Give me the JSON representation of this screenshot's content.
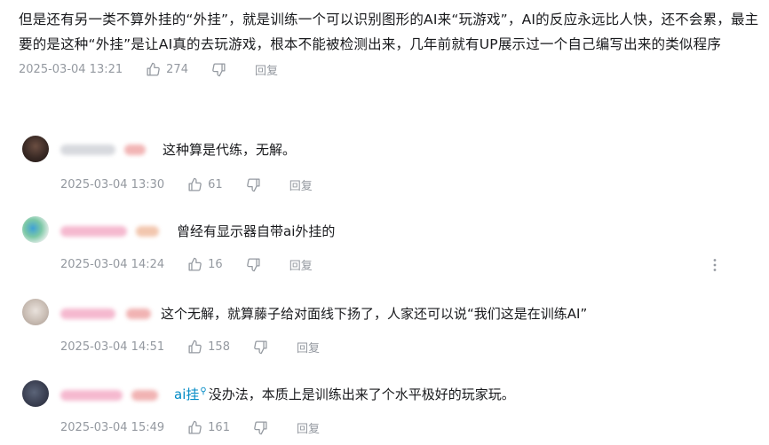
{
  "main_comment": {
    "text": "但是还有另一类不算外挂的“外挂”，就是训练一个可以识别图形的AI来“玩游戏”，AI的反应永远比人快，还不会累，最主要的是这种“外挂”是让AI真的去玩游戏，根本不能被检测出来，几年前就有UP展示过一个自己编写出来的类似程序",
    "time": "2025-03-04 13:21",
    "likes": "274",
    "reply_label": "回复"
  },
  "replies": [
    {
      "text": "这种算是代练，无解。",
      "time": "2025-03-04 13:30",
      "likes": "61",
      "reply_label": "回复"
    },
    {
      "text": "曾经有显示器自带ai外挂的",
      "time": "2025-03-04 14:24",
      "likes": "16",
      "reply_label": "回复"
    },
    {
      "text": "这个无解，就算藤子给对面线下扬了，人家还可以说“我们这是在训练AI”",
      "time": "2025-03-04 14:51",
      "likes": "158",
      "reply_label": "回复"
    },
    {
      "link": "ai挂",
      "text": "没办法，本质上是训练出来了个水平极好的玩家玩。",
      "time": "2025-03-04 15:49",
      "likes": "161",
      "reply_label": "回复"
    }
  ],
  "icons": {
    "like": "thumbs-up-icon",
    "dislike": "thumbs-down-icon",
    "more": "more-vertical-icon",
    "search": "search-icon"
  },
  "colors": {
    "meta": "#9499a0",
    "link": "#008ac5",
    "text": "#18191c"
  }
}
